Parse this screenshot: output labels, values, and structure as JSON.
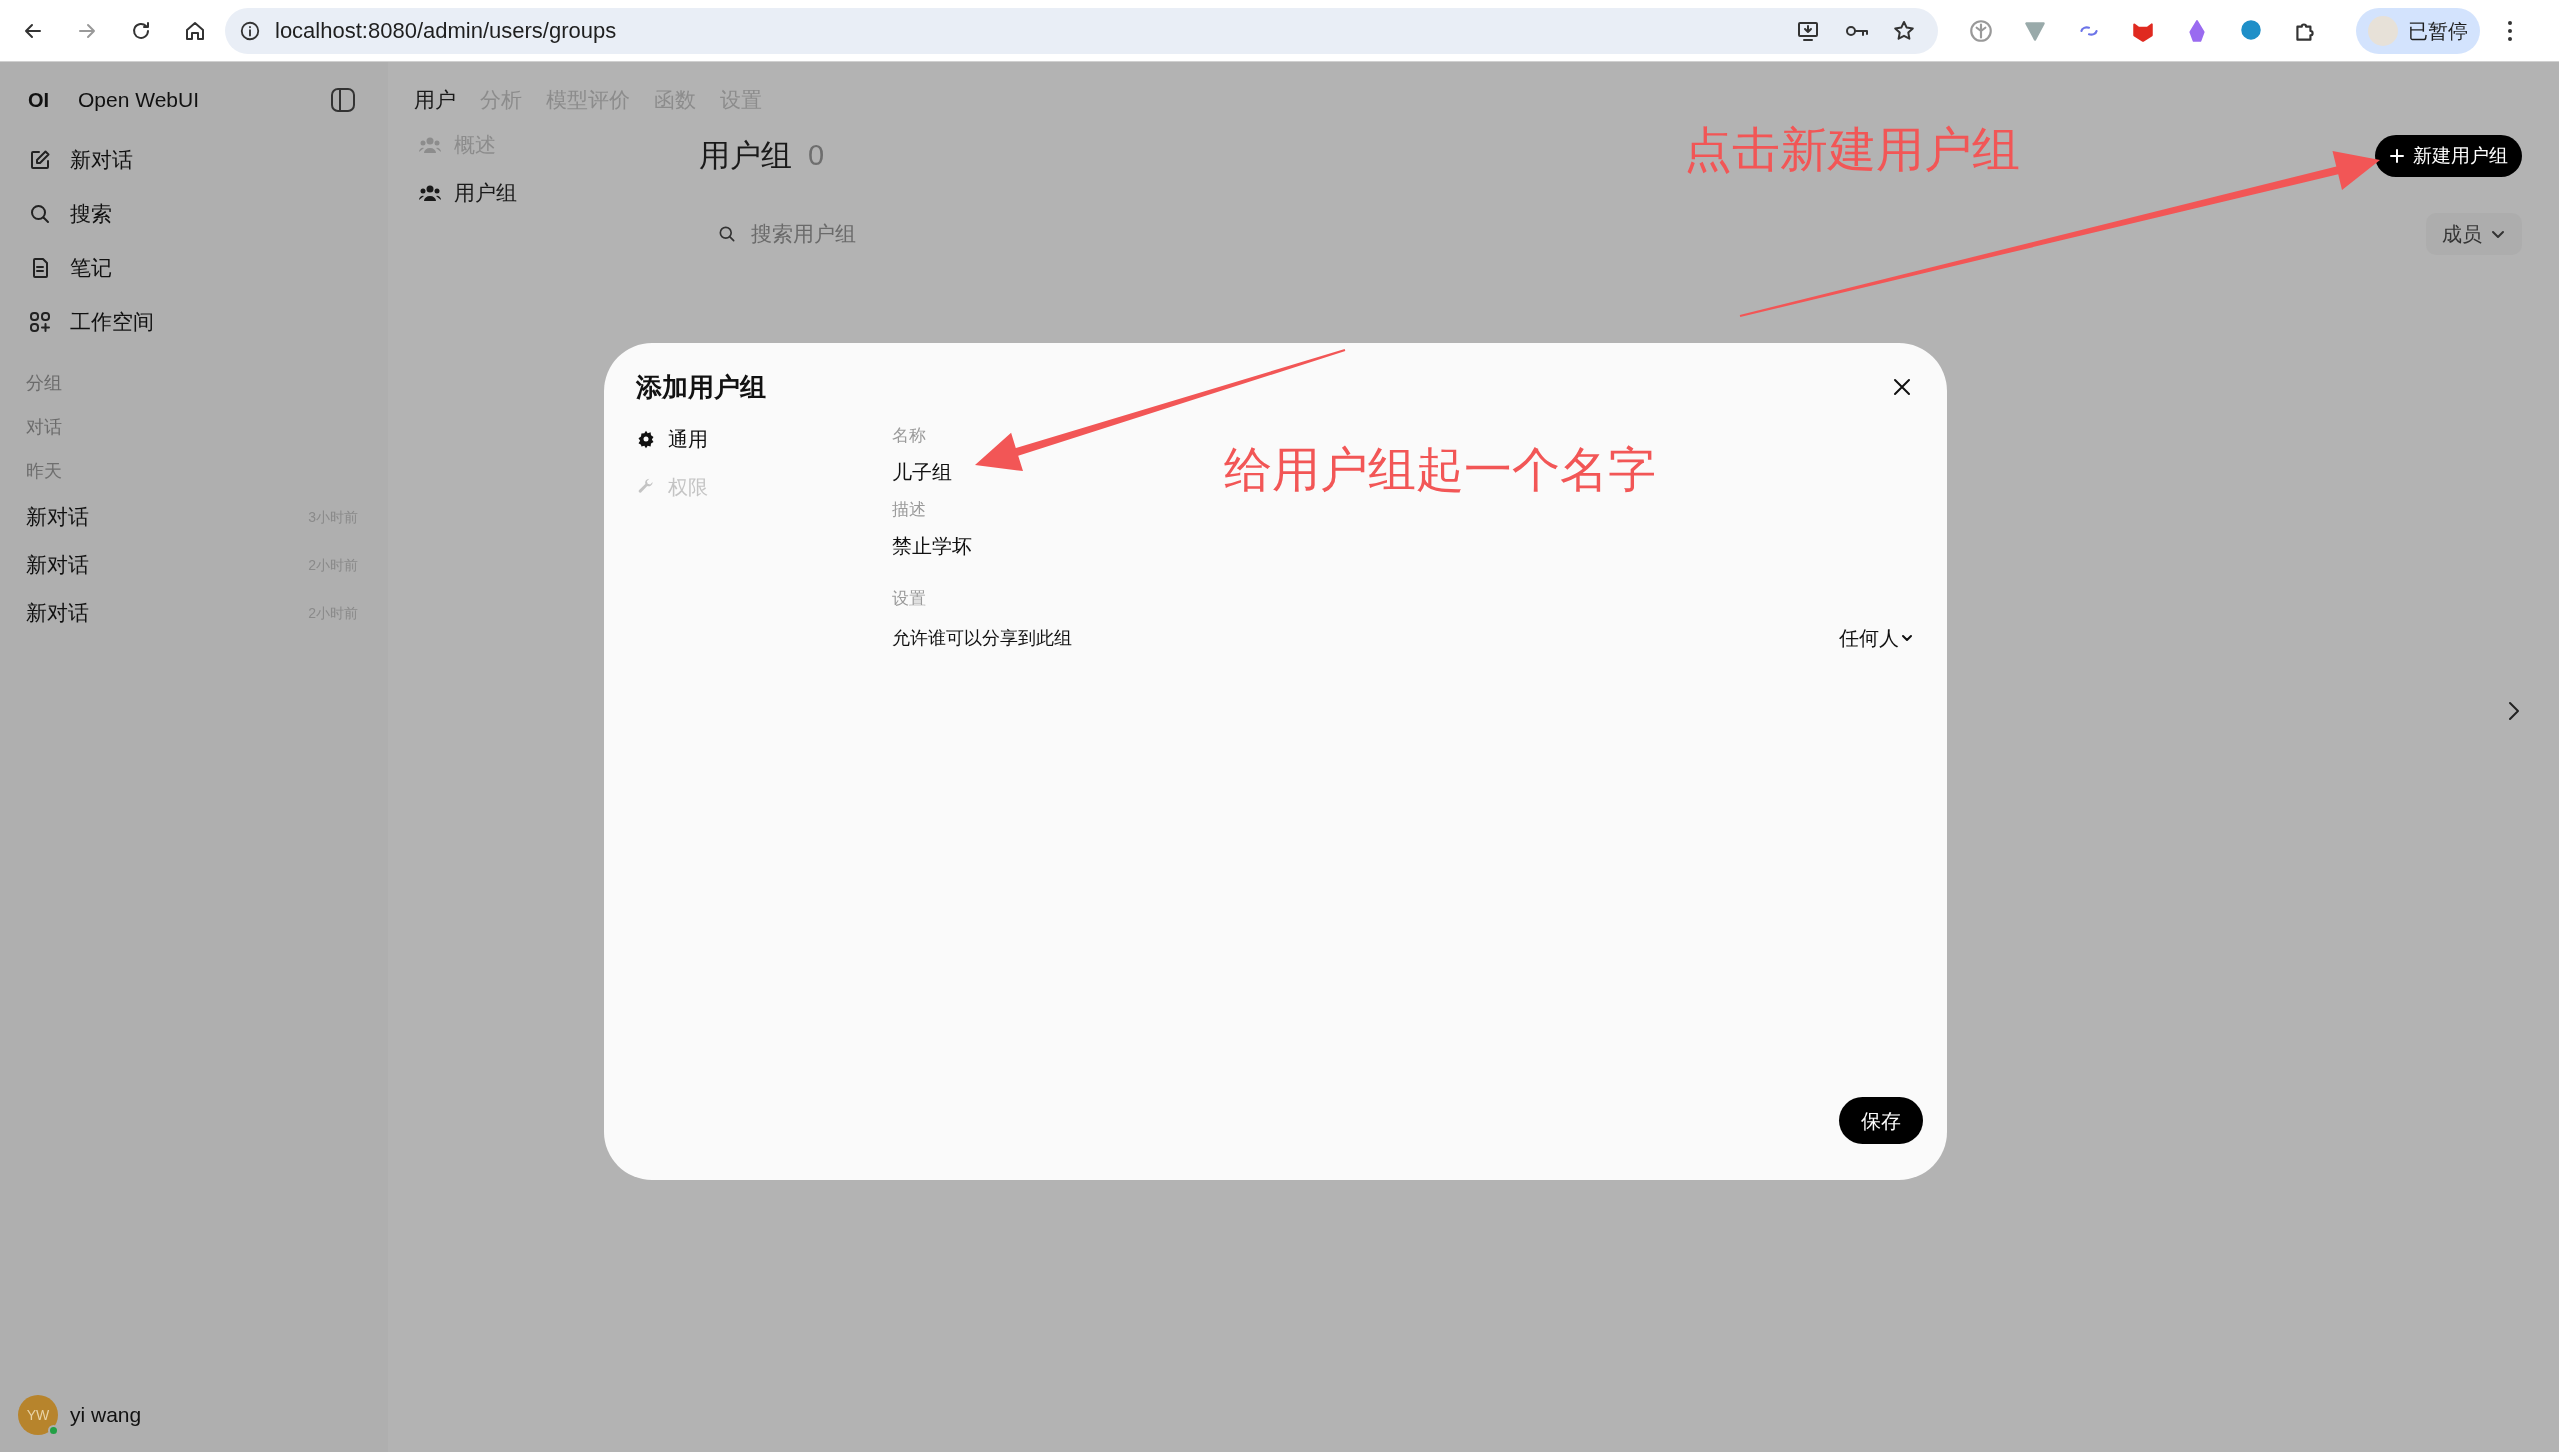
{
  "browser": {
    "url": "localhost:8080/admin/users/groups",
    "profile_label": "已暂停"
  },
  "sidebar": {
    "logo": "OI",
    "app_name": "Open WebUI",
    "nav": [
      {
        "label": "新对话"
      },
      {
        "label": "搜索"
      },
      {
        "label": "笔记"
      },
      {
        "label": "工作空间"
      }
    ],
    "section_labels": [
      "分组",
      "对话"
    ],
    "chat_groups": [
      {
        "label": "昨天",
        "chats": [
          {
            "title": "新对话",
            "time": "3小时前"
          },
          {
            "title": "新对话",
            "time": "2小时前"
          },
          {
            "title": "新对话",
            "time": "2小时前"
          }
        ]
      }
    ],
    "user": {
      "initials": "YW",
      "name": "yi wang",
      "online": true
    }
  },
  "main": {
    "tabs": [
      {
        "label": "用户",
        "selected": true
      },
      {
        "label": "分析",
        "selected": false
      },
      {
        "label": "模型评价",
        "selected": false
      },
      {
        "label": "函数",
        "selected": false
      },
      {
        "label": "设置",
        "selected": false
      }
    ],
    "subnav": [
      {
        "label": "概述",
        "selected": false
      },
      {
        "label": "用户组",
        "selected": true
      }
    ],
    "heading": "用户组",
    "count": "0",
    "search": {
      "placeholder": "搜索用户组"
    },
    "new_button": "新建用户组",
    "sort": "成员"
  },
  "modal": {
    "title": "添加用户组",
    "tabs": [
      {
        "label": "通用",
        "selected": true
      },
      {
        "label": "权限",
        "selected": false
      }
    ],
    "fields": [
      {
        "label": "名称",
        "value": "儿子组"
      },
      {
        "label": "描述",
        "value": "禁止学坏"
      }
    ],
    "settings_label": "设置",
    "settings": [
      {
        "label": "允许谁可以分享到此组",
        "value": "任何人"
      }
    ],
    "save": "保存"
  },
  "annotations": [
    {
      "text": "点击新建用户组"
    },
    {
      "text": "给用户组起一个名字"
    }
  ]
}
